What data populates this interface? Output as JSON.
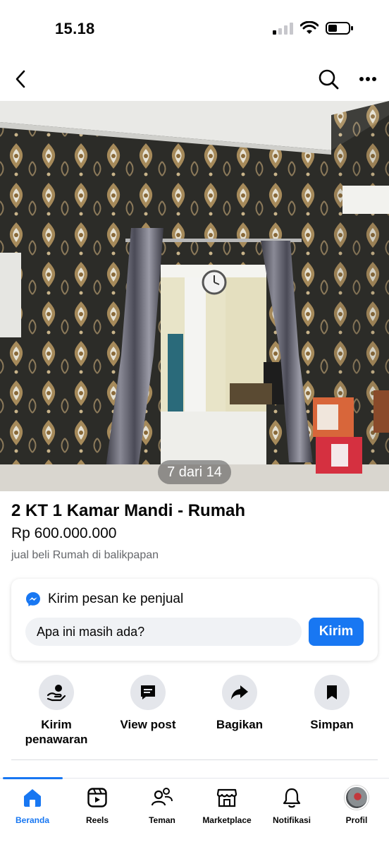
{
  "status": {
    "time": "15.18"
  },
  "photo": {
    "counter": "7 dari 14"
  },
  "listing": {
    "title": "2 KT 1 Kamar Mandi - Rumah",
    "price": "Rp 600.000.000",
    "category": "jual beli Rumah di balikpapan"
  },
  "message": {
    "heading": "Kirim pesan ke penjual",
    "input_value": "Apa ini masih ada?",
    "send_label": "Kirim"
  },
  "actions": [
    {
      "label": "Kirim penawaran",
      "icon": "offer-icon"
    },
    {
      "label": "View post",
      "icon": "post-icon"
    },
    {
      "label": "Bagikan",
      "icon": "share-icon"
    },
    {
      "label": "Simpan",
      "icon": "bookmark-icon"
    }
  ],
  "tabs": [
    {
      "label": "Beranda",
      "icon": "home-icon",
      "active": true
    },
    {
      "label": "Reels",
      "icon": "reels-icon"
    },
    {
      "label": "Teman",
      "icon": "friends-icon"
    },
    {
      "label": "Marketplace",
      "icon": "marketplace-icon"
    },
    {
      "label": "Notifikasi",
      "icon": "bell-icon"
    },
    {
      "label": "Profil",
      "icon": "avatar"
    }
  ],
  "colors": {
    "accent": "#1877f2",
    "text": "#050505",
    "secondary_text": "#65676b",
    "chip_bg": "#e4e6eb"
  }
}
